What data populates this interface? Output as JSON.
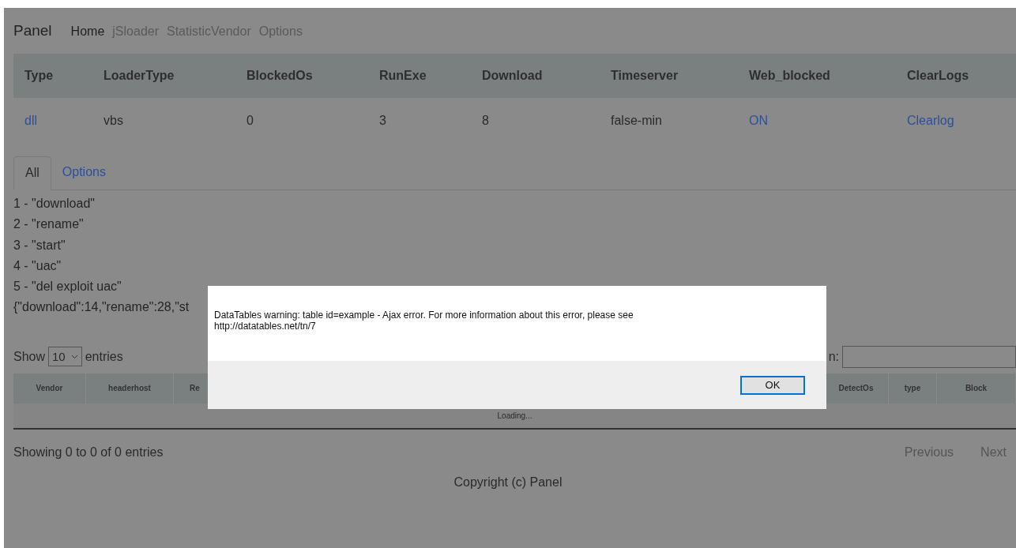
{
  "navbar": {
    "brand": "Panel",
    "links": [
      {
        "label": "Home",
        "selected": true
      },
      {
        "label": "jSloader",
        "selected": false
      },
      {
        "label": "StatisticVendor",
        "selected": false
      },
      {
        "label": "Options",
        "selected": false
      }
    ]
  },
  "summary_table": {
    "columns": [
      "Type",
      "LoaderType",
      "BlockedOs",
      "RunExe",
      "Download",
      "Timeserver",
      "Web_blocked",
      "ClearLogs"
    ],
    "row": [
      {
        "text": "dll",
        "link": true
      },
      {
        "text": "vbs",
        "link": false
      },
      {
        "text": "0",
        "link": false
      },
      {
        "text": "3",
        "link": false
      },
      {
        "text": "8",
        "link": false
      },
      {
        "text": "false-min",
        "link": false
      },
      {
        "text": "ON",
        "link": true
      },
      {
        "text": "Clearlog",
        "link": true
      }
    ]
  },
  "tabs": [
    {
      "label": "All",
      "selected": true
    },
    {
      "label": "Options",
      "selected": false
    }
  ],
  "log_lines": [
    "1 - \"download\"",
    "2 - \"rename\"",
    "3 - \"start\"",
    "4 - \"uac\"",
    "5 - \"del exploit uac\""
  ],
  "json_line": "{\"download\":14,\"rename\":28,\"st",
  "datatable": {
    "show_label": "Show",
    "length_value": "10",
    "entries_label": "entries",
    "search_label": "n:",
    "columns": [
      "Vendor",
      "headerhost",
      "Re",
      "DetectOs",
      "type",
      "Block"
    ],
    "loading": "Loading...",
    "info": "Showing 0 to 0 of 0 entries",
    "pagination": [
      {
        "label": "Previous",
        "disabled": true
      },
      {
        "label": "Next",
        "disabled": true
      }
    ]
  },
  "footer": "Copyright (c) Panel",
  "dialog": {
    "message": "DataTables warning: table id=example - Ajax error. For more information about this error, please see http://datatables.net/tn/7",
    "button": "OK"
  }
}
